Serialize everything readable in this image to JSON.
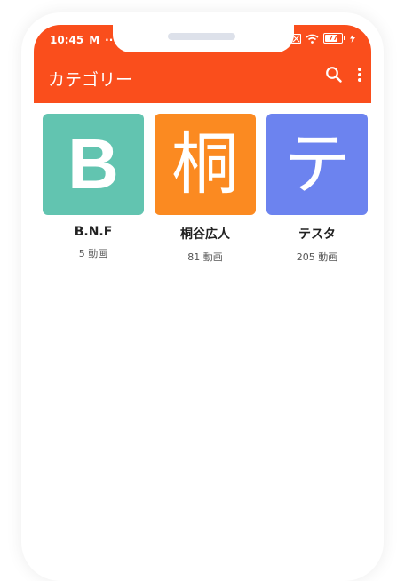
{
  "colors": {
    "brand": "#fa4e1c",
    "tile_teal": "#62c4b0",
    "tile_orange": "#fb8a21",
    "tile_blue": "#6c83ef"
  },
  "status_bar": {
    "time": "10:45",
    "app_letter": "M",
    "more": "···",
    "battery_level": "77"
  },
  "appbar": {
    "title": "カテゴリー",
    "search_icon": "search-icon",
    "menu_icon": "more-vert-icon"
  },
  "categories": [
    {
      "thumb": "B",
      "name": "B.N.F",
      "count": "5 動画",
      "color": "#62c4b0"
    },
    {
      "thumb": "桐",
      "name": "桐谷広人",
      "count": "81 動画",
      "color": "#fb8a21"
    },
    {
      "thumb": "テ",
      "name": "テスタ",
      "count": "205 動画",
      "color": "#6c83ef"
    }
  ]
}
